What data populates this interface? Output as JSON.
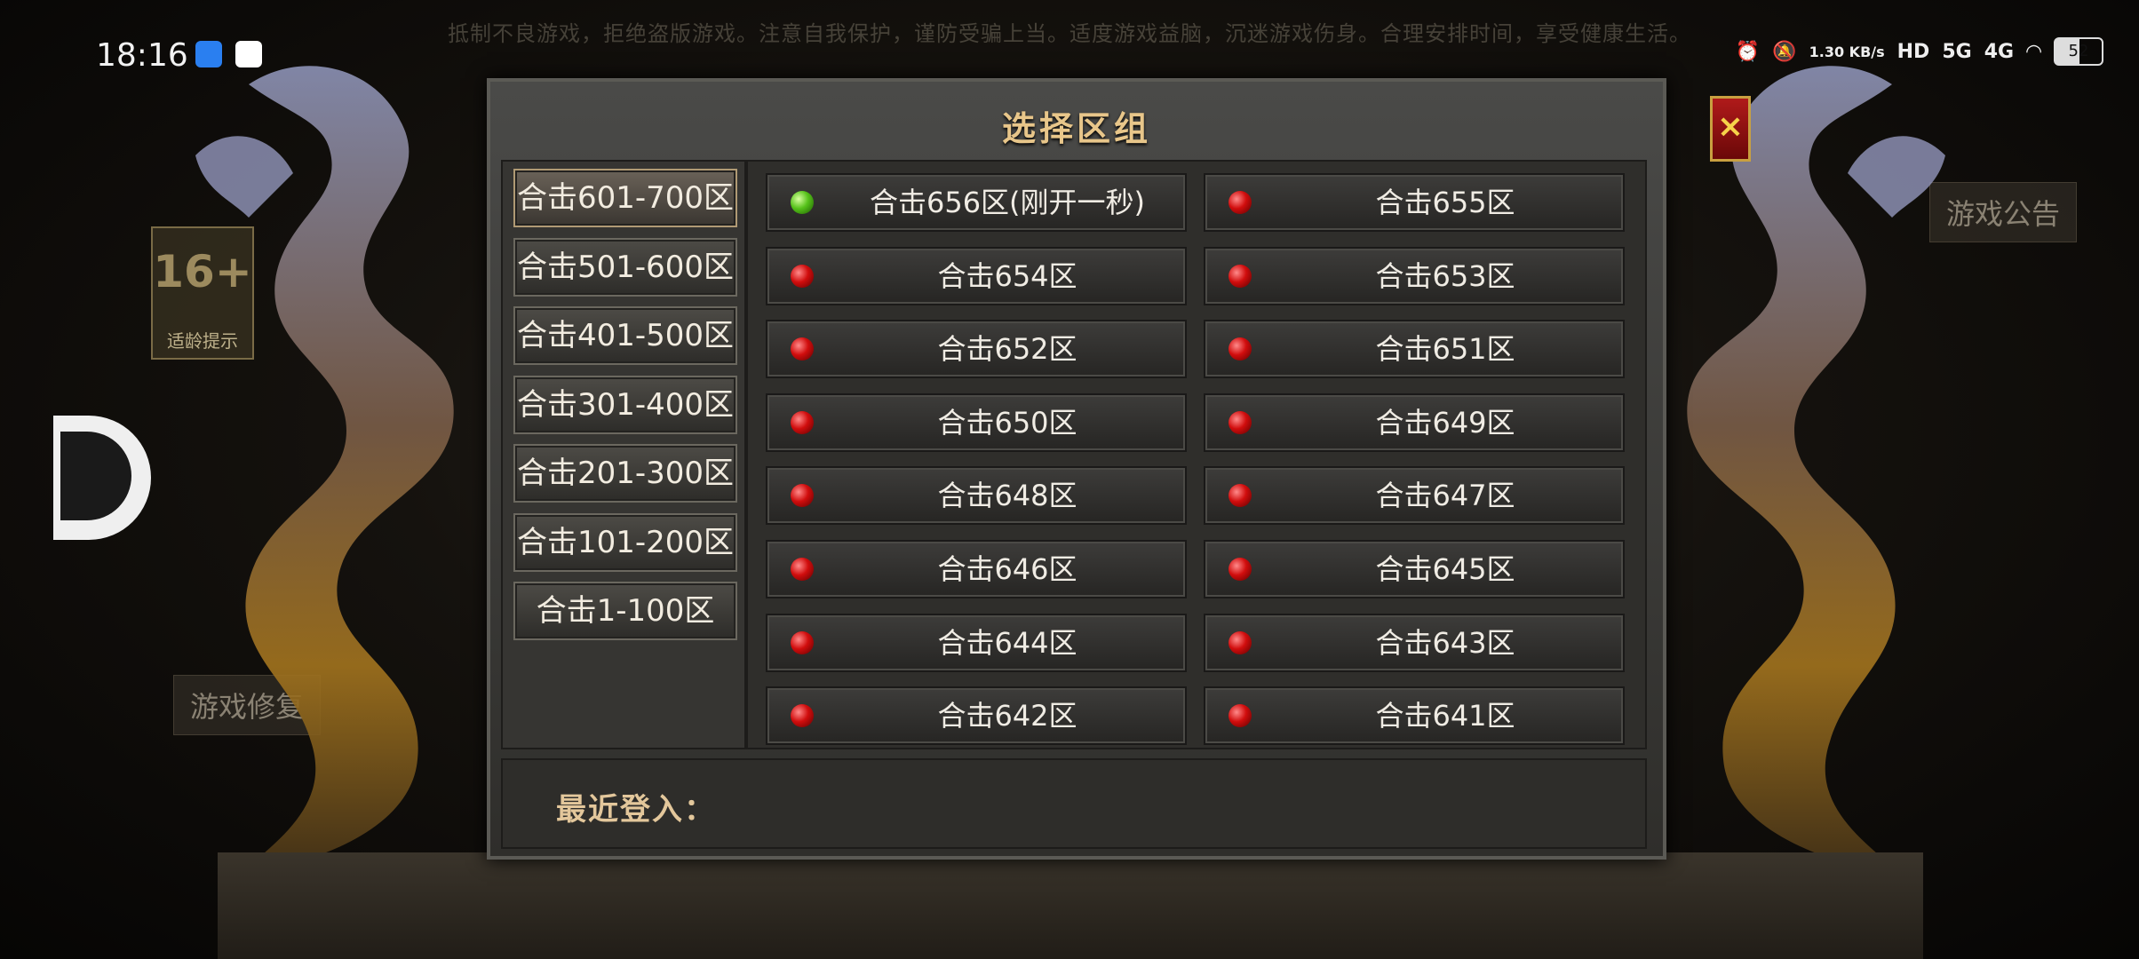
{
  "notice": "抵制不良游戏，拒绝盗版游戏。注意自我保护，谨防受骗上当。适度游戏益脑，沉迷游戏伤身。合理安排时间，享受健康生活。",
  "status_bar": {
    "time": "18:16",
    "net_speed": "1.30 KB/s",
    "hd": "HD",
    "sig1": "5G",
    "sig2": "4G",
    "battery": "52"
  },
  "side": {
    "age_badge_value": "16+",
    "age_badge_label": "适龄提示",
    "game_notice": "游戏公告",
    "game_repair": "游戏修复"
  },
  "dialog": {
    "title": "选择区组",
    "close_label": "×",
    "recent_label": "最近登入："
  },
  "groups": [
    {
      "label": "合击601-700区",
      "active": true
    },
    {
      "label": "合击501-600区",
      "active": false
    },
    {
      "label": "合击401-500区",
      "active": false
    },
    {
      "label": "合击301-400区",
      "active": false
    },
    {
      "label": "合击201-300区",
      "active": false
    },
    {
      "label": "合击101-200区",
      "active": false
    },
    {
      "label": "合击1-100区",
      "active": false
    }
  ],
  "servers": [
    {
      "name": "合击656区(刚开一秒)",
      "status": "green"
    },
    {
      "name": "合击655区",
      "status": "red"
    },
    {
      "name": "合击654区",
      "status": "red"
    },
    {
      "name": "合击653区",
      "status": "red"
    },
    {
      "name": "合击652区",
      "status": "red"
    },
    {
      "name": "合击651区",
      "status": "red"
    },
    {
      "name": "合击650区",
      "status": "red"
    },
    {
      "name": "合击649区",
      "status": "red"
    },
    {
      "name": "合击648区",
      "status": "red"
    },
    {
      "name": "合击647区",
      "status": "red"
    },
    {
      "name": "合击646区",
      "status": "red"
    },
    {
      "name": "合击645区",
      "status": "red"
    },
    {
      "name": "合击644区",
      "status": "red"
    },
    {
      "name": "合击643区",
      "status": "red"
    },
    {
      "name": "合击642区",
      "status": "red"
    },
    {
      "name": "合击641区",
      "status": "red"
    }
  ]
}
